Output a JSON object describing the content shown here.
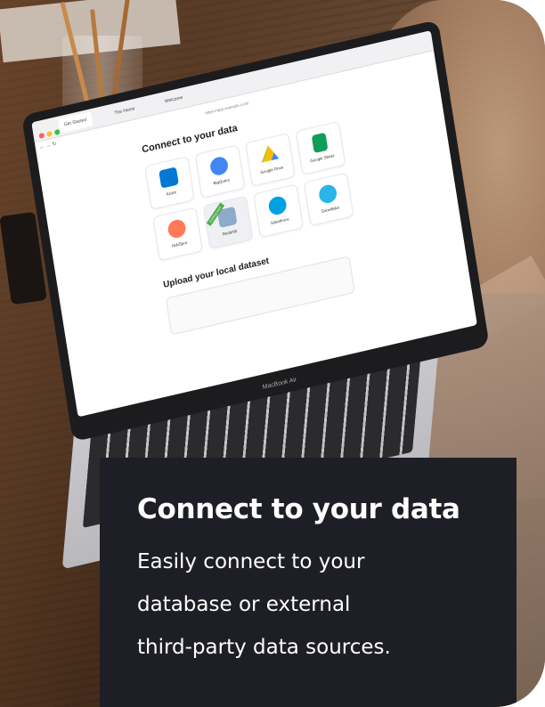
{
  "panel": {
    "title": "Connect to your data",
    "lines": [
      "Easily connect to your",
      "database or external",
      "third-party data sources."
    ]
  },
  "laptop": {
    "brand_label": "MacBook Air",
    "browser": {
      "tabs": [
        "Get Started",
        "The Home",
        "Welcome"
      ],
      "url": "https://app.example.com/"
    },
    "screen": {
      "connect_title": "Connect to your data",
      "connectors": [
        {
          "label": "Azure",
          "icon": "azure-icon",
          "color": "#0078d4"
        },
        {
          "label": "BigQuery",
          "icon": "bigquery-icon",
          "color": "#4285f4"
        },
        {
          "label": "Google Drive",
          "icon": "google-drive-icon",
          "color": "#34a853"
        },
        {
          "label": "Google Sheet",
          "icon": "google-sheets-icon",
          "color": "#0f9d58"
        },
        {
          "label": "HubSpot",
          "icon": "hubspot-icon",
          "color": "#ff7a59"
        },
        {
          "label": "Redshift",
          "icon": "redshift-icon",
          "color": "#8fa9c9",
          "badge": "Coming soon"
        },
        {
          "label": "Salesforce",
          "icon": "salesforce-icon",
          "color": "#00a1e0"
        },
        {
          "label": "Snowflake",
          "icon": "snowflake-icon",
          "color": "#29b5e8"
        }
      ],
      "upload_title": "Upload your local dataset"
    }
  },
  "colors": {
    "panel_bg": "#1e1f26",
    "panel_text": "#ffffff"
  }
}
